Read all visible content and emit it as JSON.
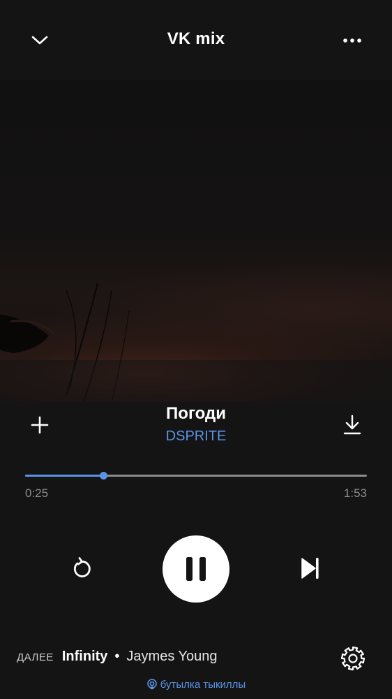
{
  "header": {
    "title": "VK mix",
    "collapse_icon": "chevron-down-icon",
    "more_icon": "more-dots-icon"
  },
  "track": {
    "title": "Погоди",
    "artist": "DSPRITE"
  },
  "progress": {
    "current_time": "0:25",
    "total_time": "1:53",
    "fraction": 0.228
  },
  "controls": {
    "repeat_icon": "repeat-icon",
    "play_pause_icon": "pause-icon",
    "next_icon": "skip-next-icon",
    "add_icon": "plus-icon",
    "download_icon": "download-icon"
  },
  "up_next": {
    "label": "ДАЛЕЕ",
    "song": "Infinity",
    "separator": "•",
    "artist": "Jaymes Young"
  },
  "device": {
    "name": "бутылка тыкиллы",
    "icon": "broadcast-icon"
  },
  "colors": {
    "background": "#141414",
    "accent": "#5b93e6",
    "text": "#ffffff",
    "muted": "#8e8e8e"
  }
}
